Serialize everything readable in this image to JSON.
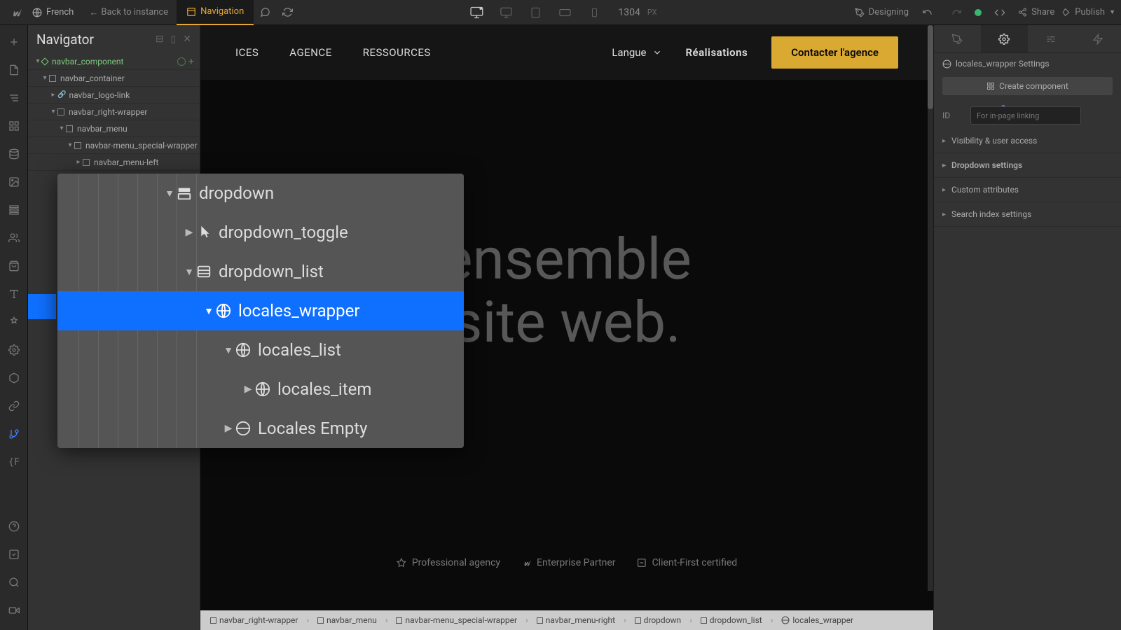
{
  "topbar": {
    "language": "French",
    "back_label": "Back to instance",
    "nav_label": "Navigation",
    "px_value": "1304",
    "px_unit": "PX",
    "designing": "Designing",
    "share": "Share",
    "publish": "Publish"
  },
  "navigator": {
    "title": "Navigator",
    "tree": {
      "component": "navbar_component",
      "container": "navbar_container",
      "logo_link": "navbar_logo-link",
      "right_wrapper": "navbar_right-wrapper",
      "menu": "navbar_menu",
      "special_wrapper": "navbar-menu_special-wrapper",
      "menu_left": "navbar_menu-left"
    }
  },
  "zoom": {
    "dropdown": "dropdown",
    "dropdown_toggle": "dropdown_toggle",
    "dropdown_list": "dropdown_list",
    "locales_wrapper": "locales_wrapper",
    "locales_list": "locales_list",
    "locales_item": "locales_item",
    "locales_empty": "Locales Empty"
  },
  "site_nav": {
    "item1_partial": "ICES",
    "item2": "AGENCE",
    "item3": "RESSOURCES",
    "langue": "Langue",
    "realisations": "Réalisations",
    "cta": "Contacter l'agence"
  },
  "hero": {
    "line1_partial": "ensemble",
    "line2_partial": "site web."
  },
  "badges": {
    "prof": "Professional agency",
    "partner": "Enterprise Partner",
    "cf": "Client-First certified"
  },
  "breadcrumb": {
    "b1": "navbar_right-wrapper",
    "b2": "navbar_menu",
    "b3": "navbar-menu_special-wrapper",
    "b4": "navbar_menu-right",
    "b5": "dropdown",
    "b6": "dropdown_list",
    "b7": "locales_wrapper"
  },
  "right_panel": {
    "selector_title": "locales_wrapper Settings",
    "create": "Create component",
    "id_label": "ID",
    "id_placeholder": "For in-page linking",
    "visibility": "Visibility & user access",
    "dropdown_settings": "Dropdown settings",
    "custom_attrs": "Custom attributes",
    "search_index": "Search index settings"
  }
}
